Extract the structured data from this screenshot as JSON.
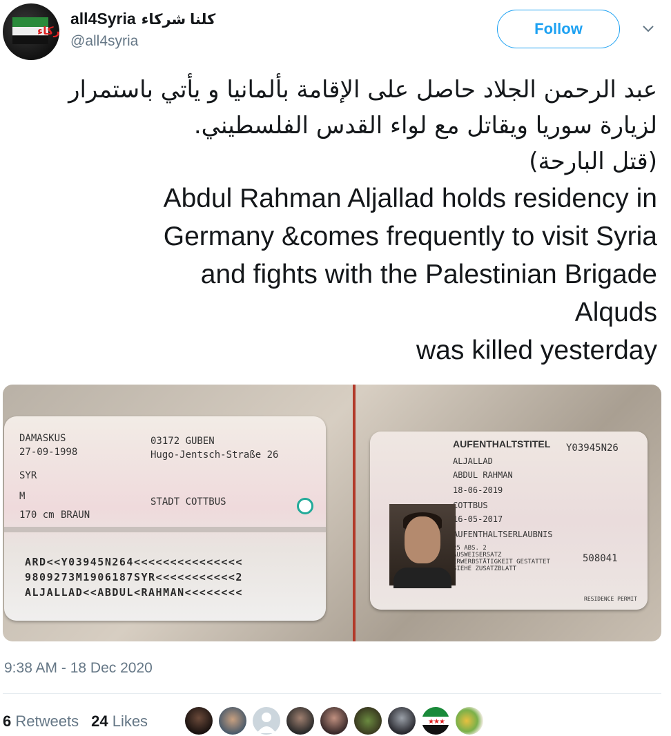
{
  "author": {
    "display_name": "all4Syria",
    "display_name_ar": "كلنا شركاء",
    "handle": "@all4syria",
    "avatar_text": "شركاء"
  },
  "follow_label": "Follow",
  "tweet": {
    "lines_ar": [
      "عبد الرحمن الجلاد حاصل على الإقامة بألمانيا و يأتي باستمرار",
      "لزيارة سوريا ويقاتل مع لواء القدس الفلسطيني.",
      "(قتل البارحة)"
    ],
    "lines_en": [
      "Abdul Rahman Aljallad holds residency in",
      "Germany &comes frequently to visit Syria",
      "and fights with the Palestinian Brigade",
      "Alquds",
      "was killed yesterday"
    ]
  },
  "card_left": {
    "birth_place": "DAMASKUS",
    "birth_date": "27-09-1998",
    "nationality": "SYR",
    "sex": "M",
    "height": "170 cm",
    "eye_color": "BRAUN",
    "postal": "03172 GUBEN",
    "street": "Hugo-Jentsch-Straße 26",
    "authority": "STADT COTTBUS",
    "mrz": [
      "ARD<<Y03945N264<<<<<<<<<<<<<<<",
      "9809273M1906187SYR<<<<<<<<<<<2",
      "ALJALLAD<<ABDUL<RAHMAN<<<<<<<<"
    ]
  },
  "card_right": {
    "title": "AUFENTHALTSTITEL",
    "doc_number": "Y03945N26",
    "surname": "ALJALLAD",
    "given": "ABDUL RAHMAN",
    "valid_until": "18-06-2019",
    "place": "COTTBUS",
    "issued": "16-05-2017",
    "type": "AUFENTHALTSERLAUBNIS",
    "note1": "25 ABS. 2",
    "note2": "AUSWEISERSATZ",
    "note3": "ERWERBSTÄTIGKEIT GESTATTET",
    "note4": "SIEHE ZUSATZBLATT",
    "serial": "508041",
    "footer": "RESIDENCE PERMIT"
  },
  "timestamp": "9:38 AM - 18 Dec 2020",
  "stats": {
    "retweets_count": "6",
    "retweets_label": "Retweets",
    "likes_count": "24",
    "likes_label": "Likes"
  }
}
